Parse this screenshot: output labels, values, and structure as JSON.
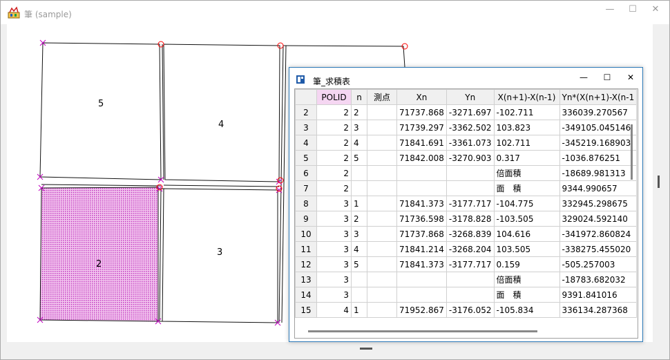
{
  "window": {
    "title": "筆 (sample)",
    "icons": {
      "app": "map-app-icon",
      "minimize": "minimize-icon",
      "maximize": "maximize-icon",
      "close": "close-icon"
    }
  },
  "map": {
    "parcels": [
      {
        "id": "5",
        "label": "5"
      },
      {
        "id": "4",
        "label": "4"
      },
      {
        "id": "2",
        "label": "2",
        "selected": true
      },
      {
        "id": "3",
        "label": "3"
      }
    ],
    "colors": {
      "selected_fill": "#e88be0",
      "vertex_mark": "#c000c0",
      "arrow": "#ff0000"
    }
  },
  "table_window": {
    "title": "筆_求積表",
    "icons": {
      "window": "table-window-icon",
      "minimize": "minimize-icon",
      "maximize": "maximize-icon",
      "close": "close-icon"
    },
    "columns": [
      "",
      "POLID",
      "n",
      "測点",
      "Xn",
      "Yn",
      "X(n+1)-X(n-1)",
      "Yn*(X(n+1)-X(n-1"
    ],
    "rows": [
      [
        "2",
        "2",
        "2",
        "",
        "71737.868",
        "-3271.697",
        "-102.711",
        "336039.270567"
      ],
      [
        "3",
        "2",
        "3",
        "",
        "71739.297",
        "-3362.502",
        "103.823",
        "-349105.045146"
      ],
      [
        "4",
        "2",
        "4",
        "",
        "71841.691",
        "-3361.073",
        "102.711",
        "-345219.168903"
      ],
      [
        "5",
        "2",
        "5",
        "",
        "71842.008",
        "-3270.903",
        "0.317",
        "-1036.876251"
      ],
      [
        "6",
        "2",
        "",
        "",
        "",
        "",
        "倍面積",
        "-18689.981313"
      ],
      [
        "7",
        "2",
        "",
        "",
        "",
        "",
        "面　積",
        "9344.990657"
      ],
      [
        "8",
        "3",
        "1",
        "",
        "71841.373",
        "-3177.717",
        "-104.775",
        "332945.298675"
      ],
      [
        "9",
        "3",
        "2",
        "",
        "71736.598",
        "-3178.828",
        "-103.505",
        "329024.592140"
      ],
      [
        "10",
        "3",
        "3",
        "",
        "71737.868",
        "-3268.839",
        "104.616",
        "-341972.860824"
      ],
      [
        "11",
        "3",
        "4",
        "",
        "71841.214",
        "-3268.204",
        "103.505",
        "-338275.455020"
      ],
      [
        "12",
        "3",
        "5",
        "",
        "71841.373",
        "-3177.717",
        "0.159",
        "-505.257003"
      ],
      [
        "13",
        "3",
        "",
        "",
        "",
        "",
        "倍面積",
        "-18783.682032"
      ],
      [
        "14",
        "3",
        "",
        "",
        "",
        "",
        "面　積",
        "9391.841016"
      ],
      [
        "15",
        "4",
        "1",
        "",
        "71952.867",
        "-3176.052",
        "-105.834",
        "336134.287368"
      ]
    ]
  }
}
